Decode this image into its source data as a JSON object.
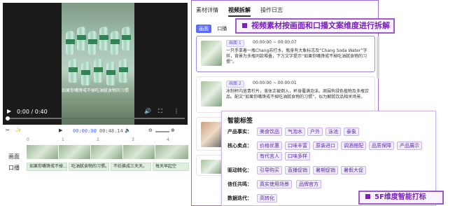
{
  "player": {
    "subtitle": "如果你嘴馋戒不掉吃油腻食物的习惯",
    "time_display": "0:00 / 0:40",
    "timecode_current": "00:00:00",
    "timecode_total": "00:48.14"
  },
  "timeline": {
    "ruler_marks": [
      "0",
      "1",
      "2",
      "3",
      "4"
    ],
    "track_labels": {
      "video": "画面",
      "voice": "口播"
    },
    "captions": [
      "如果你嘴馋戒不掉...",
      "吃油腻食物的习惯。",
      "不妨换成三天天。",
      "每天早起空"
    ]
  },
  "right_panel": {
    "tabs": [
      "素材详情",
      "视频拆解",
      "操作日志"
    ],
    "active_tab": 1,
    "segment": {
      "on": "画面",
      "off": "口播"
    },
    "cards": [
      {
        "pill": "画面 1",
        "time": "00:00:00 ~ 00:00:07",
        "desc": "一只手拿着一瓶Chang苏打水，瓶身有大象标志及“Chang Soda Water”字样，背景为多瓶同款堆叠，下方文字提示“如果你嘴馋戒不掉吃油腻食物的习惯”。"
      },
      {
        "pill": "画面 2",
        "time": "00:00:00 ~ 00:00:01",
        "desc": "冰制杯内放青柠片，液体正被倒入，杯身覆满泡沫。周围有绿色植物及多瓶饮品。配文“如果你嘴馋戒不掉吃油腻食物的习惯”，似为解腻饮品相关场景。"
      }
    ]
  },
  "callouts": {
    "decompose": "视频素材按画面和口播文案维度进行拆解",
    "tagging": "5F维度智能打标"
  },
  "smart_tags": {
    "title": "智能标签",
    "rows": [
      {
        "label": "产品事实：",
        "tags": [
          "美食饮品",
          "气泡水",
          "户外",
          "泳池",
          "泰象"
        ]
      },
      {
        "label": "核心卖点：",
        "tags": [
          "价格优惠",
          "口味丰富",
          "原装进口",
          "调酒搭配",
          "品质保障",
          "产品展示",
          "有代言人",
          "口味多样"
        ]
      },
      {
        "label": "驱动转化：",
        "tags": [
          "引导购买",
          "直播促销",
          "暑期促销",
          "暑假大促"
        ]
      },
      {
        "label": "信任共鸣：",
        "tags": [
          "真实使用场景",
          "品牌官方"
        ]
      },
      {
        "label": "数据迭代：",
        "tags": [
          "高转化"
        ]
      }
    ]
  },
  "colors": {
    "accent": "#5b6bff",
    "callout_border": "#9b59d4",
    "callout_text": "#7a1fb8",
    "tag_text": "#5b2ea8"
  }
}
